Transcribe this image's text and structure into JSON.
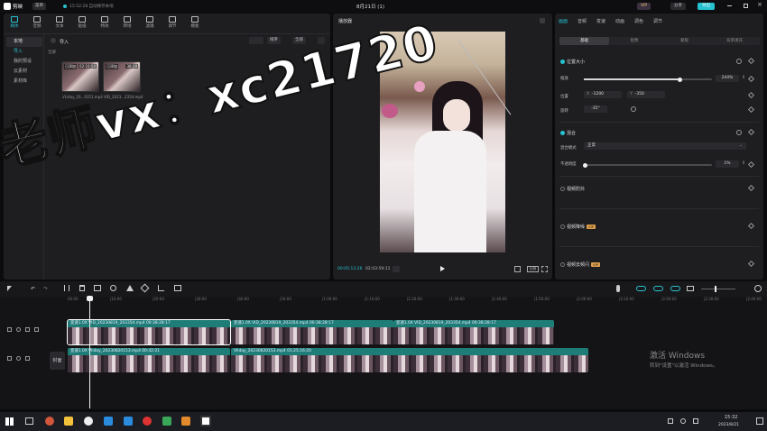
{
  "app": {
    "name": "剪映",
    "menu_label": "菜单",
    "autosave_text": "15:52:28 自动保存本地",
    "project_title": "8月21日 (1)",
    "vip_label": "VIP",
    "share_label": "分享",
    "export_label": "导出"
  },
  "toolbar": {
    "items": [
      {
        "label": "媒体"
      },
      {
        "label": "音频"
      },
      {
        "label": "文本"
      },
      {
        "label": "贴纸"
      },
      {
        "label": "特效"
      },
      {
        "label": "转场"
      },
      {
        "label": "滤镜"
      },
      {
        "label": "调节"
      },
      {
        "label": "模板"
      }
    ]
  },
  "media": {
    "sidebar": [
      "本地",
      "导入",
      "我的预设",
      "云素材",
      "素材库"
    ],
    "import_label": "导入",
    "all_label": "全部",
    "sort_label": "排序",
    "filter_label": "全部",
    "clips": [
      {
        "badge": "已添加",
        "duration": "02:10:50",
        "name": "VLiday_20...0151.mp4"
      },
      {
        "badge": "已添加",
        "duration": "38:28",
        "name": "VID_2023...2354.mp4"
      }
    ]
  },
  "player": {
    "title": "播放器",
    "current_time": "00:05:13:26",
    "total_time": "02:03:59:11"
  },
  "overlay": {
    "watermark": "老师vx：xc21720"
  },
  "inspector": {
    "tabs": [
      "画面",
      "音频",
      "变速",
      "动画",
      "调色",
      "调节"
    ],
    "subtabs": [
      "基础",
      "抠像",
      "蒙版",
      "背景填充"
    ],
    "position_size": {
      "title": "位置大小",
      "scale_label": "缩放",
      "scale_value": "244%",
      "scale_level": 0.75,
      "position_label": "位置",
      "x_label": "X",
      "x_value": "-1200",
      "y_label": "Y",
      "y_value": "-350",
      "rotate_label": "旋转",
      "rotate_value": "-35°"
    },
    "blend": {
      "title": "混合",
      "mode_label": "混合模式",
      "mode_value": "正常",
      "opacity_label": "不透明度",
      "opacity_value": "1%",
      "opacity_level": 0.01
    },
    "sections": [
      {
        "label": "视频防抖",
        "vip": false
      },
      {
        "label": "视频降噪",
        "vip": true
      },
      {
        "label": "视频去频闪",
        "vip": true
      }
    ]
  },
  "timeline": {
    "ruler": [
      "00:00",
      "|10:00",
      "|20:00",
      "|30:00",
      "|40:00",
      "|50:00",
      "|1:00:00",
      "|1:10:00",
      "|1:20:00",
      "|1:30:00",
      "|1:40:00",
      "|1:50:00",
      "|2:00:00",
      "|2:10:00",
      "|2:20:00",
      "|2:30:00",
      "|2:40:00",
      "|2:50:00"
    ],
    "cover_label": "封面",
    "track1": [
      {
        "text": "变速1.0X  VID_20230819_203354.mp4  00:38:28:17"
      },
      {
        "text": "变速1.0X  VID_20230819_203354.mp4  00:38:28:17"
      },
      {
        "text": "变速1.0X  VID_20230819_203354.mp4  00:38:28:17"
      }
    ],
    "track2": [
      {
        "text": "变速1.0X  Vliday_20230820153.mp4  00:42:21"
      },
      {
        "text": "Vliday_20230820153.mp4  01:25:16:20"
      }
    ]
  },
  "activation": {
    "line1": "激活 Windows",
    "line2": "转到\"设置\"以激活 Windows。"
  },
  "taskbar": {
    "time": "15:32",
    "date": "2023/8/21"
  },
  "colors": {
    "accent": "#27c2d0",
    "clip_teal": "#1f7d78",
    "panel": "#1e1e21"
  }
}
